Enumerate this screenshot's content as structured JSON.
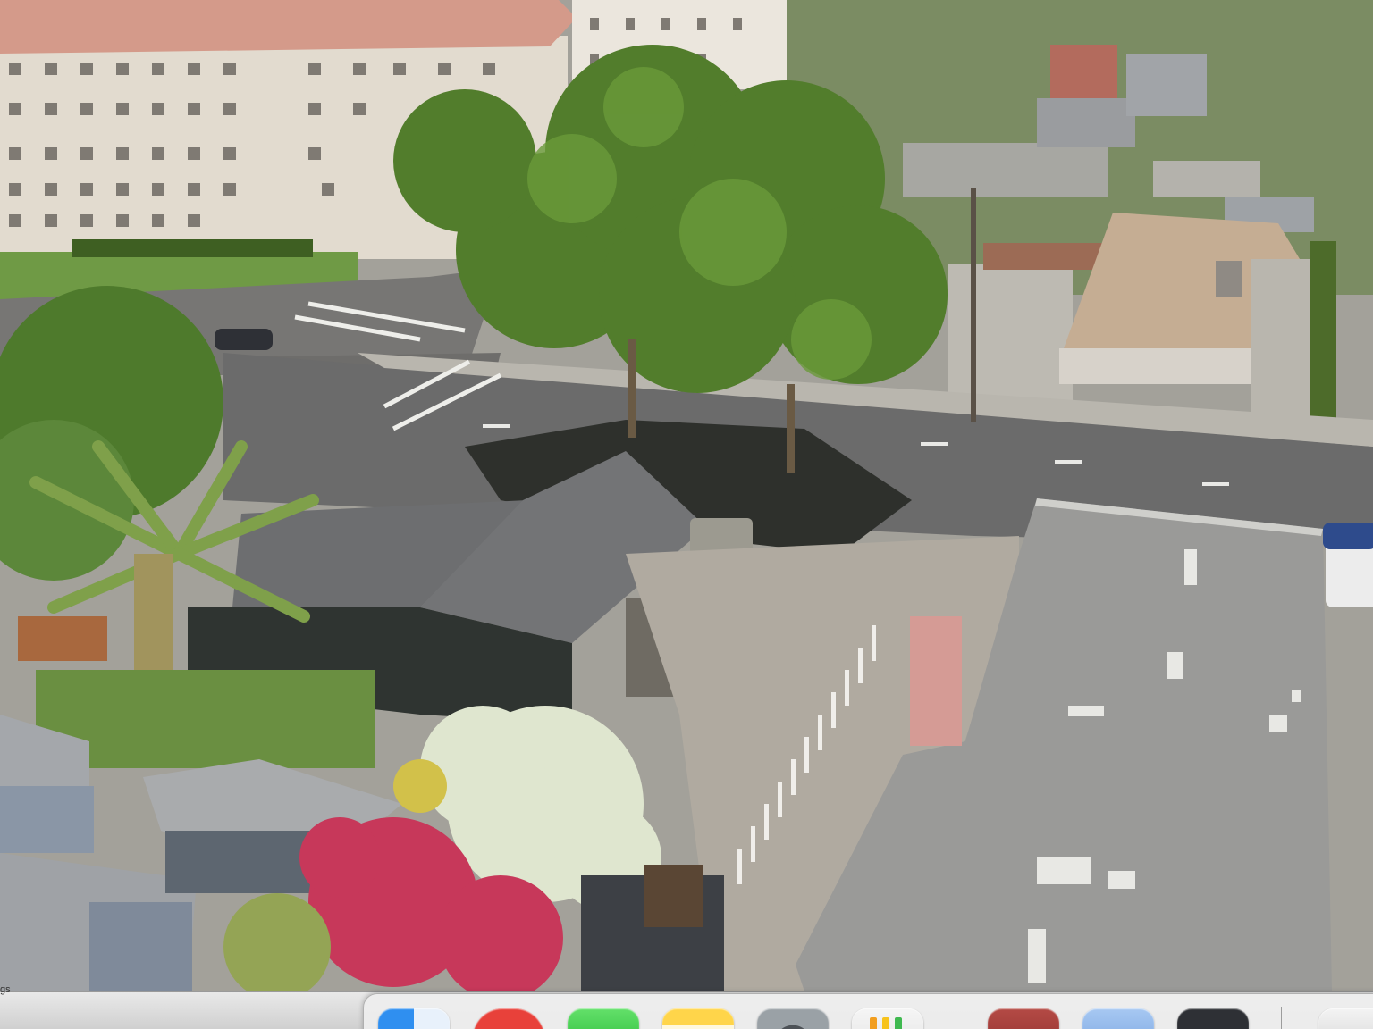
{
  "screen": {
    "viewer_title": "",
    "corner_label": "gs",
    "photo_description_hidden": ""
  },
  "dock": {
    "items": [
      {
        "name": "finder",
        "icon": "finder-icon"
      },
      {
        "name": "red-app",
        "icon": "red-app-icon"
      },
      {
        "name": "messages",
        "icon": "messages-icon"
      },
      {
        "name": "notes",
        "icon": "notes-icon"
      },
      {
        "name": "system-settings",
        "icon": "gear-icon"
      },
      {
        "name": "numbers",
        "icon": "numbers-icon"
      },
      {
        "name": "maroon-app",
        "icon": "maroon-app-icon"
      },
      {
        "name": "preview",
        "icon": "preview-icon"
      },
      {
        "name": "quicktime",
        "icon": "quicktime-icon"
      },
      {
        "name": "trash",
        "icon": "trash-icon"
      }
    ]
  },
  "colors": {
    "road": "#6f6f6f",
    "grass": "#5f8a3b",
    "tree": "#4f7a2a",
    "roof_dark": "#6d6e70",
    "roof_flat": "#9b9b9b",
    "building_cream": "#e4ddd2",
    "building_roof": "#d99a8c",
    "flowers_pink": "#c8385f",
    "flowers_white": "#e8eddc"
  }
}
